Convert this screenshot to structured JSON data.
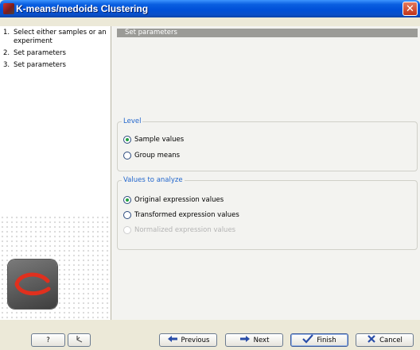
{
  "window": {
    "title": "K-means/medoids Clustering",
    "close_glyph": "✕"
  },
  "steps": [
    {
      "num": "1.",
      "label": "Select either samples or an experiment"
    },
    {
      "num": "2.",
      "label": "Set parameters"
    },
    {
      "num": "3.",
      "label": "Set parameters"
    }
  ],
  "main": {
    "section_title": "Set parameters",
    "level": {
      "legend": "Level",
      "options": [
        {
          "label": "Sample values",
          "selected": true
        },
        {
          "label": "Group means",
          "selected": false
        }
      ]
    },
    "values": {
      "legend": "Values to analyze",
      "options": [
        {
          "label": "Original expression values",
          "selected": true,
          "enabled": true
        },
        {
          "label": "Transformed expression values",
          "selected": false,
          "enabled": true
        },
        {
          "label": "Normalized expression values",
          "selected": false,
          "enabled": false
        }
      ]
    }
  },
  "buttons": {
    "help": {
      "label": "?"
    },
    "reset": {
      "icon": "reset-icon"
    },
    "previous": {
      "label": "Previous",
      "icon": "arrow-left-icon"
    },
    "next": {
      "label": "Next",
      "icon": "arrow-right-icon"
    },
    "finish": {
      "label": "Finish",
      "icon": "checkmark-icon"
    },
    "cancel": {
      "label": "Cancel",
      "icon": "x-icon"
    }
  },
  "colors": {
    "accent": "#2266cc",
    "title_bar": "#0a5fe0",
    "radio_selected": "#20a040"
  }
}
